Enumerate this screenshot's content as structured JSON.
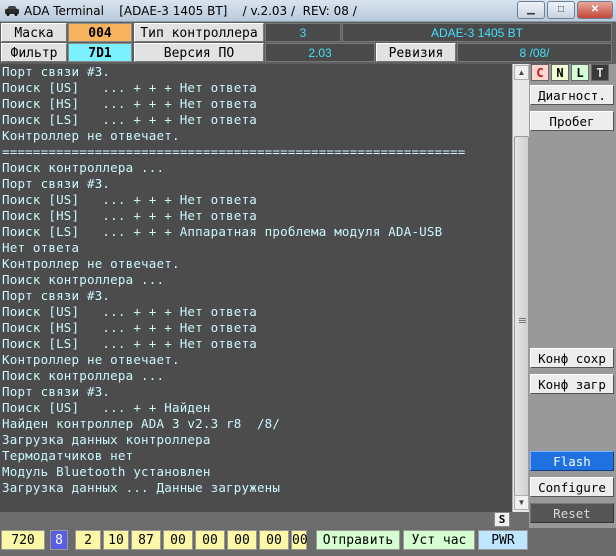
{
  "window": {
    "app_name": "ADA Terminal",
    "title_rest": "[ADAE-3 1405 BT]    / v.2.03 /  REV: 08 /",
    "min_label": "▁",
    "max_label": "□",
    "close_label": "✕"
  },
  "header": {
    "mask_label": "Маска",
    "mask_value": "004",
    "filter_label": "Фильтр",
    "filter_value": "7D1",
    "controller_type_label": "Тип контроллера",
    "controller_num": "3",
    "controller_name": "ADAE-3 1405 BT",
    "version_label": "Версия ПО",
    "version_value": "2.03",
    "revision_label": "Ревизия",
    "revision_value": "8  /08/"
  },
  "terminal": {
    "lines": [
      "Порт связи #3.",
      "Поиск [US]   ... + + + Нет ответа",
      "Поиск [HS]   ... + + + Нет ответа",
      "Поиск [LS]   ... + + + Нет ответа",
      "Контроллер не отвечает.",
      "============================================================",
      "Поиск контроллера ...",
      "Порт связи #3.",
      "Поиск [US]   ... + + + Нет ответа",
      "Поиск [HS]   ... + + + Нет ответа",
      "Поиск [LS]   ... + + + Аппаратная проблема модуля ADA-USB",
      "Нет ответа",
      "Контроллер не отвечает.",
      "Поиск контроллера ...",
      "Порт связи #3.",
      "Поиск [US]   ... + + + Нет ответа",
      "Поиск [HS]   ... + + + Нет ответа",
      "Поиск [LS]   ... + + + Нет ответа",
      "Контроллер не отвечает.",
      "Поиск контроллера ...",
      "Порт связи #3.",
      "Поиск [US]   ... + + Найден",
      "Найден контроллер ADA 3 v2.3 r8  /8/",
      "Загрузка данных контроллера",
      "Термодатчиков нет",
      "Модуль Bluetooth установлен",
      "Загрузка данных ... Данные загружены"
    ],
    "s_button": "S"
  },
  "right_panel": {
    "c_label": "C",
    "n_label": "N",
    "l_label": "L",
    "t_label": "T",
    "diag_label": "Диагност.",
    "run_label": "Пробег",
    "conf_save_label": "Конф сохр",
    "conf_load_label": "Конф загр",
    "flash_label": "Flash",
    "configure_label": "Configure",
    "reset_label": "Reset"
  },
  "bottom": {
    "counter": "720",
    "num8": "8",
    "bytes": [
      "2",
      "10",
      "87",
      "00",
      "00",
      "00",
      "00",
      "00"
    ],
    "send_label": "Отправить",
    "clock_label": "Уст час",
    "pwr_label": "PWR"
  },
  "colors": {
    "terminal_bg": "#4c4c4c",
    "terminal_text": "#cbf7ff",
    "flash_btn": "#1f70e0",
    "mask_value_bg": "#f7b35e",
    "filter_value_bg": "#7bf0ff"
  }
}
